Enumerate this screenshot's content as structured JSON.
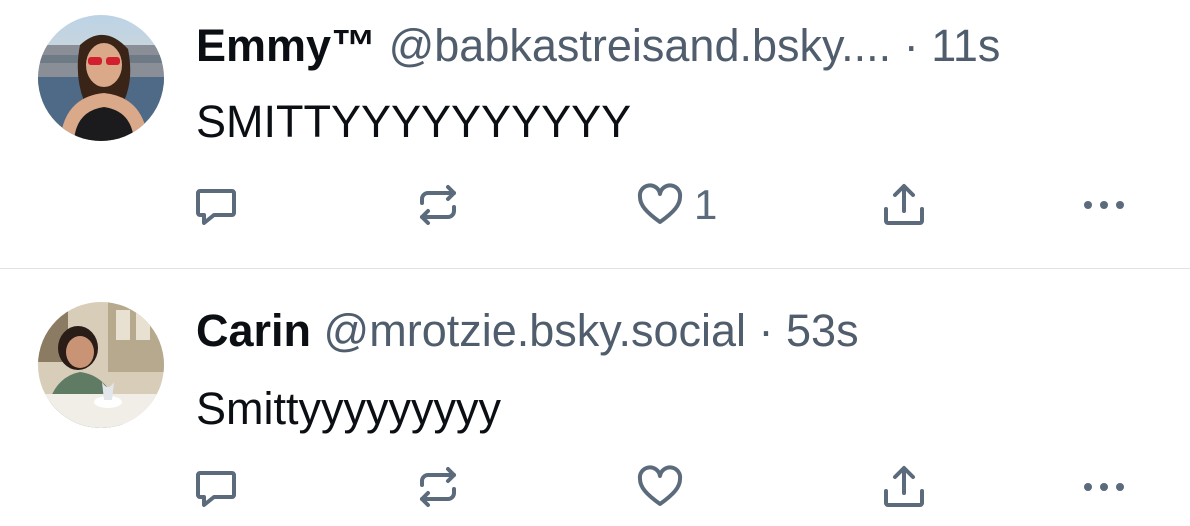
{
  "posts": [
    {
      "author_name": "Emmy™",
      "handle": "@babkastreisand.bsky....",
      "separator": "·",
      "time": "11s",
      "text": "SMITTYYYYYYYYYY",
      "like_count": "1",
      "icons": [
        "reply-icon",
        "repost-icon",
        "heart-icon",
        "share-icon",
        "more-icon"
      ]
    },
    {
      "author_name": "Carin",
      "handle": "@mrotzie.bsky.social",
      "separator": "·",
      "time": "53s",
      "text": "Smittyyyyyyyyy",
      "like_count": "",
      "icons": [
        "reply-icon",
        "repost-icon",
        "heart-icon",
        "share-icon",
        "more-icon"
      ]
    }
  ],
  "colors": {
    "text": "#0b0f14",
    "muted": "#4f5d6d",
    "icon": "#5b6b7c",
    "divider": "#dfe3e8"
  }
}
